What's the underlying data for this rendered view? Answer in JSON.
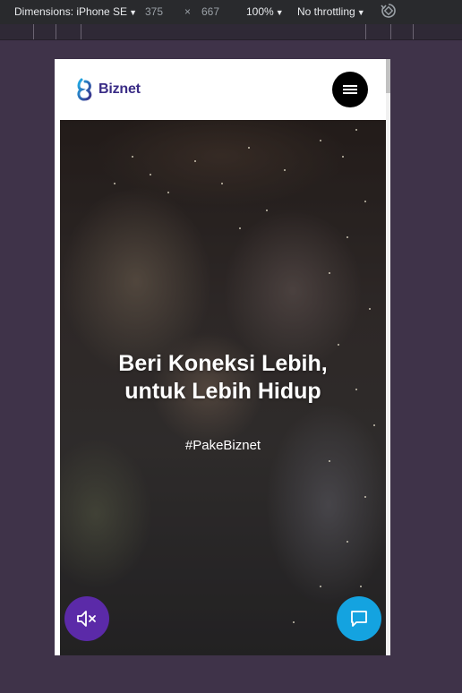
{
  "devtools": {
    "dimensions_label": "Dimensions: iPhone SE",
    "width": "375",
    "times": "×",
    "height": "667",
    "zoom": "100%",
    "throttling": "No throttling",
    "caret": "▼"
  },
  "site": {
    "logo_text": "Biznet",
    "brand_color": "#3a2c86",
    "menu_icon": "hamburger-icon"
  },
  "hero": {
    "title_line1": "Beri Koneksi Lebih,",
    "title_line2": "untuk Lebih Hidup",
    "tagline": "#PakeBiznet"
  },
  "buttons": {
    "mute_icon": "volume-mute-icon",
    "mute_color": "#5b2aa8",
    "chat_icon": "chat-bubble-icon",
    "chat_color": "#14a3e0"
  }
}
